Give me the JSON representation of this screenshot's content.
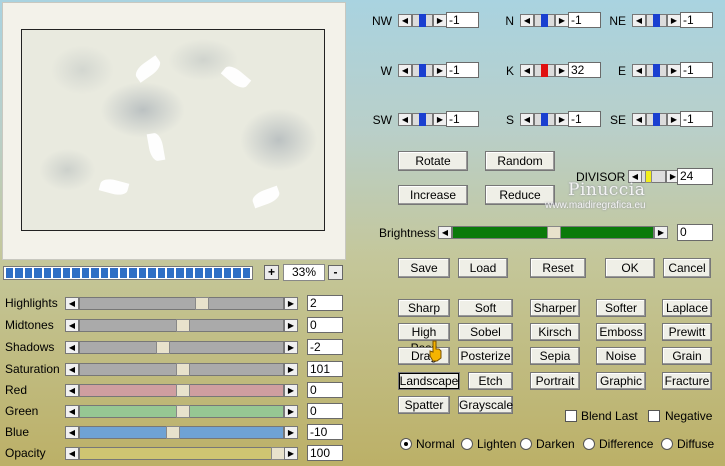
{
  "zoom": {
    "plus": "+",
    "minus": "-",
    "value": "33%"
  },
  "progress_segments": 26,
  "adjustments": [
    {
      "name": "highlights",
      "label": "Highlights",
      "value": "2",
      "level": 0.6,
      "track": "#aaaaaa"
    },
    {
      "name": "midtones",
      "label": "Midtones",
      "value": "0",
      "level": 0.5,
      "track": "#aaaaaa"
    },
    {
      "name": "shadows",
      "label": "Shadows",
      "value": "-2",
      "level": 0.4,
      "track": "#aaaaaa"
    },
    {
      "name": "saturation",
      "label": "Saturation",
      "value": "101",
      "level": 0.5,
      "track": "#aaaaaa"
    },
    {
      "name": "red",
      "label": "Red",
      "value": "0",
      "level": 0.5,
      "track": "#cf9ea0"
    },
    {
      "name": "green",
      "label": "Green",
      "value": "0",
      "level": 0.5,
      "track": "#96c793"
    },
    {
      "name": "blue",
      "label": "Blue",
      "value": "-10",
      "level": 0.45,
      "track": "#6fa2d4"
    },
    {
      "name": "opacity",
      "label": "Opacity",
      "value": "100",
      "level": 1.0,
      "track": "#cfc572"
    }
  ],
  "kernel": [
    {
      "name": "nw",
      "label": "NW",
      "value": "-1",
      "thumb": "blue"
    },
    {
      "name": "n",
      "label": "N",
      "value": "-1",
      "thumb": "blue"
    },
    {
      "name": "ne",
      "label": "NE",
      "value": "-1",
      "thumb": "blue"
    },
    {
      "name": "w",
      "label": "W",
      "value": "-1",
      "thumb": "blue"
    },
    {
      "name": "k",
      "label": "K",
      "value": "32",
      "thumb": "red"
    },
    {
      "name": "e",
      "label": "E",
      "value": "-1",
      "thumb": "blue"
    },
    {
      "name": "sw",
      "label": "SW",
      "value": "-1",
      "thumb": "blue"
    },
    {
      "name": "s",
      "label": "S",
      "value": "-1",
      "thumb": "blue"
    },
    {
      "name": "se",
      "label": "SE",
      "value": "-1",
      "thumb": "blue"
    }
  ],
  "buttons": {
    "rotate": "Rotate",
    "random": "Random",
    "increase": "Increase",
    "reduce": "Reduce",
    "save": "Save",
    "load": "Load",
    "reset": "Reset",
    "ok": "OK",
    "cancel": "Cancel"
  },
  "divisor": {
    "label": "DIVISOR",
    "value": "24"
  },
  "brightness": {
    "label": "Brightness",
    "value": "0",
    "level": 0.5
  },
  "watermark": {
    "name": "Pinuccia",
    "site": "www.maidiregrafica.eu"
  },
  "presets": [
    [
      "Sharp",
      "Soft",
      "Sharper",
      "Softer",
      "Laplace"
    ],
    [
      "High Pass",
      "Sobel",
      "Kirsch",
      "Emboss",
      "Prewitt"
    ],
    [
      "Drag",
      "Posterize",
      "Sepia",
      "Noise",
      "Grain"
    ],
    [
      "Landscape",
      "Etch",
      "Portrait",
      "Graphic",
      "Fracture"
    ],
    [
      "Spatter",
      "Grayscale"
    ]
  ],
  "checkboxes": [
    {
      "label": "Blend Last",
      "checked": false
    },
    {
      "label": "Negative",
      "checked": false
    }
  ],
  "blend_modes": [
    {
      "label": "Normal",
      "selected": true
    },
    {
      "label": "Lighten",
      "selected": false
    },
    {
      "label": "Darken",
      "selected": false
    },
    {
      "label": "Difference",
      "selected": false
    },
    {
      "label": "Diffuse",
      "selected": false
    }
  ],
  "colors": {
    "bar_blue": "#2f6fc5",
    "brightness_green": "#0a7a0a",
    "divisor_yellow": "#f2ef1c"
  }
}
